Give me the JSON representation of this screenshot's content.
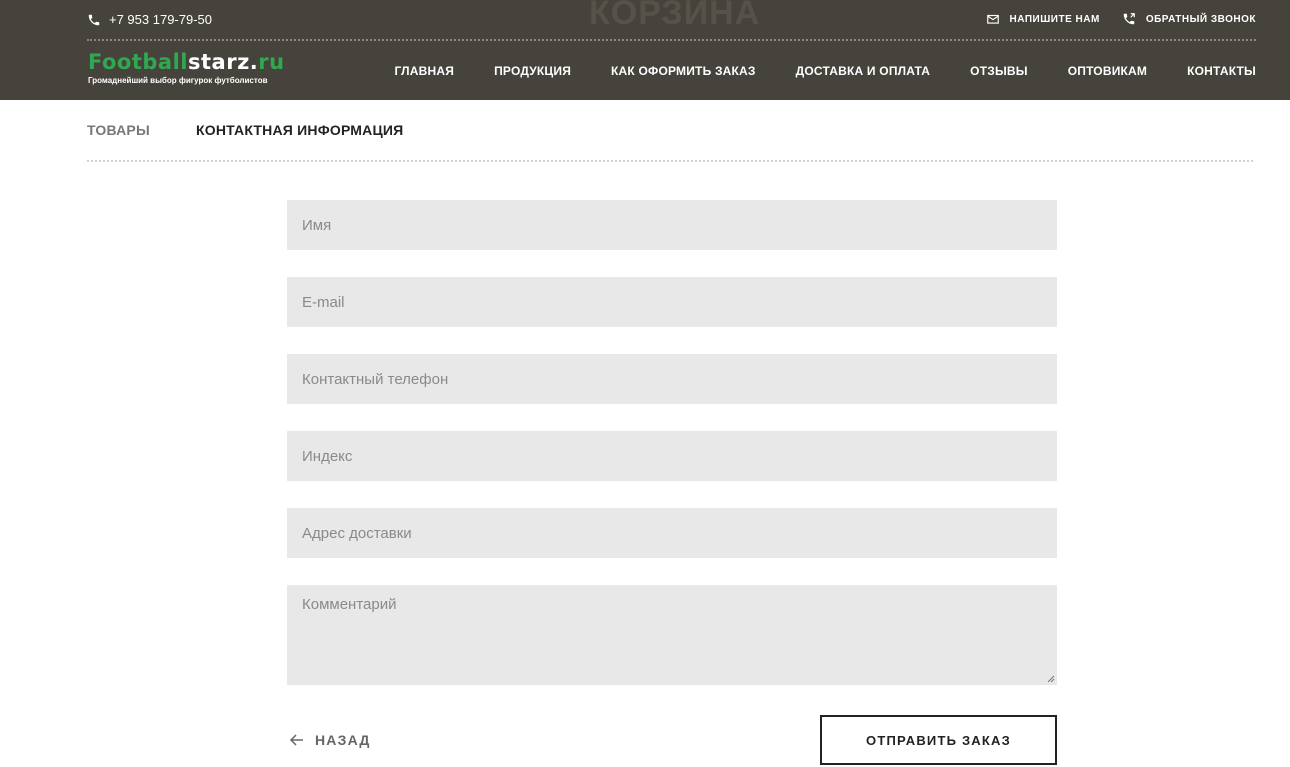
{
  "header": {
    "phone": "+7 953 179-79-50",
    "page_title": "КОРЗИНА",
    "write_us": "НАПИШИТЕ НАМ",
    "callback": "ОБРАТНЫЙ ЗВОНОК",
    "logo_part1": "Football",
    "logo_part2": "starz.",
    "logo_part3": "ru",
    "tagline": "Громаднейший выбор фигурок футболистов",
    "nav": [
      "ГЛАВНАЯ",
      "ПРОДУКЦИЯ",
      "КАК ОФОРМИТЬ ЗАКАЗ",
      "ДОСТАВКА И ОПЛАТА",
      "ОТЗЫВЫ",
      "ОПТОВИКАМ",
      "КОНТАКТЫ"
    ]
  },
  "tabs": {
    "goods": "ТОВАРЫ",
    "contact_info": "КОНТАКТНАЯ ИНФОРМАЦИЯ"
  },
  "form": {
    "name_placeholder": "Имя",
    "email_placeholder": "E-mail",
    "phone_placeholder": "Контактный телефон",
    "index_placeholder": "Индекс",
    "address_placeholder": "Адрес доставки",
    "comment_placeholder": "Комментарий"
  },
  "actions": {
    "back": "НАЗАД",
    "submit": "ОТПРАВИТЬ ЗАКАЗ"
  },
  "colors": {
    "header_bg": "#45433c",
    "logo_green": "#2fa84f",
    "field_bg": "#e8e8e8"
  }
}
